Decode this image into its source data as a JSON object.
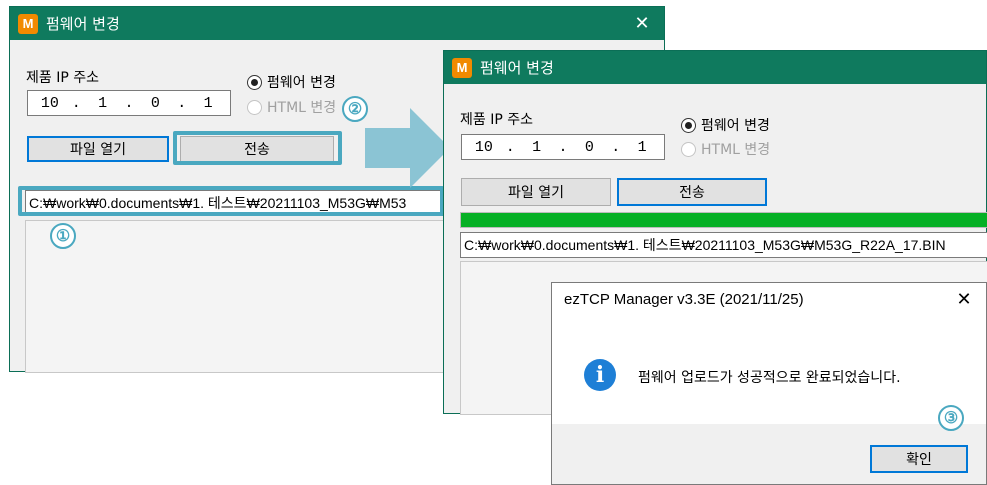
{
  "window_before": {
    "app_icon": "M",
    "title": "펌웨어 변경",
    "close_glyph": "✕",
    "ip_label": "제품 IP 주소",
    "ip": [
      "10",
      "1",
      "0",
      "1"
    ],
    "radio_firmware": "펌웨어 변경",
    "radio_html": "HTML 변경",
    "open_file_button": "파일 열기",
    "send_button": "전송",
    "file_path": "C:₩work₩0.documents₩1. 테스트₩20211103_M53G₩M53"
  },
  "window_after": {
    "app_icon": "M",
    "title": "펌웨어 변경",
    "ip_label": "제품 IP 주소",
    "ip": [
      "10",
      "1",
      "0",
      "1"
    ],
    "radio_firmware": "펌웨어 변경",
    "radio_html": "HTML 변경",
    "open_file_button": "파일 열기",
    "send_button": "전송",
    "progress_percent": 100,
    "file_path": "C:₩work₩0.documents₩1. 테스트₩20211103_M53G₩M53G_R22A_17.BIN"
  },
  "dialog": {
    "title": "ezTCP Manager v3.3E (2021/11/25)",
    "close_glyph": "✕",
    "icon": "info-icon",
    "info_glyph": "i",
    "message": "펌웨어 업로드가 성공적으로 완료되었습니다.",
    "ok_button": "확인"
  },
  "annotations": {
    "step1": "①",
    "step2": "②",
    "step3": "③",
    "highlight_color": "#4aa8c0"
  },
  "colors": {
    "titlebar": "#0f7a5e",
    "progress": "#06b025",
    "info_icon": "#1e7fd6"
  }
}
